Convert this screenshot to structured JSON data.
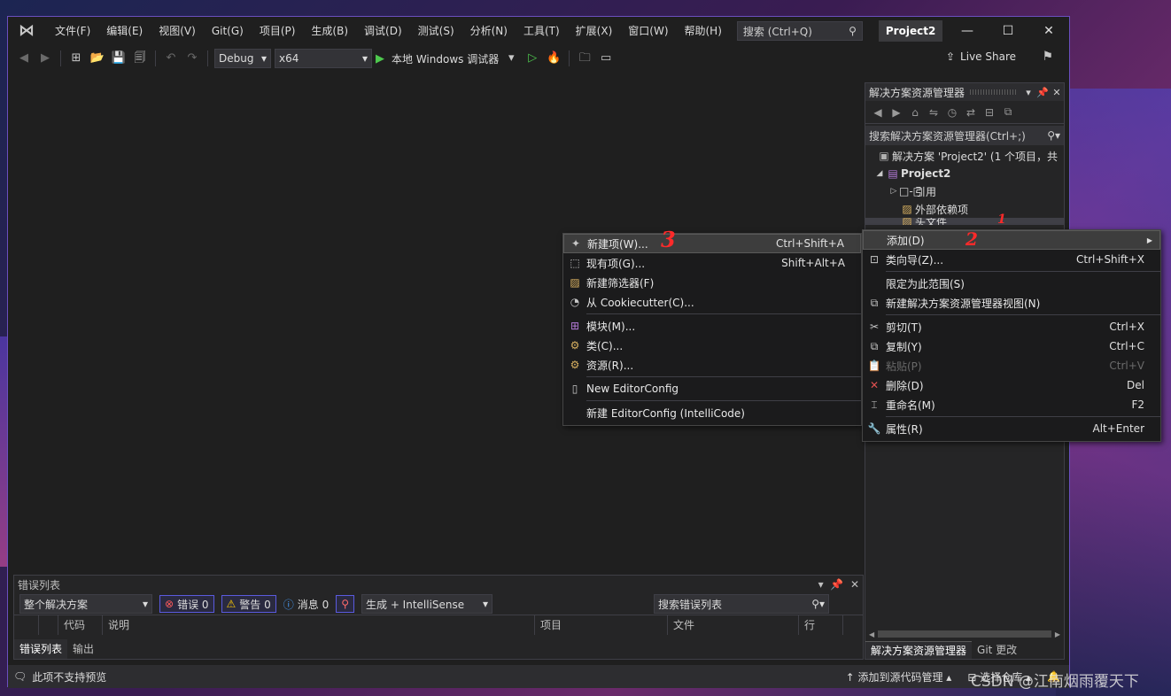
{
  "app": {
    "menu": [
      "文件(F)",
      "编辑(E)",
      "视图(V)",
      "Git(G)",
      "项目(P)",
      "生成(B)",
      "调试(D)",
      "测试(S)",
      "分析(N)",
      "工具(T)",
      "扩展(X)",
      "窗口(W)",
      "帮助(H)"
    ],
    "search_placeholder": "搜索 (Ctrl+Q)",
    "project_badge": "Project2"
  },
  "toolbar": {
    "config": "Debug",
    "platform": "x64",
    "run_label": "本地 Windows 调试器",
    "live_share": "Live Share"
  },
  "solution_explorer": {
    "title": "解决方案资源管理器",
    "search_placeholder": "搜索解决方案资源管理器(Ctrl+;)",
    "tree": [
      {
        "label": "解决方案 'Project2' (1 个项目，共",
        "level": 0
      },
      {
        "label": "Project2",
        "level": 1
      },
      {
        "label": "引用",
        "level": 2
      },
      {
        "label": "外部依赖项",
        "level": 2
      },
      {
        "label": "头文件",
        "level": 2
      }
    ],
    "tabs": [
      "解决方案资源管理器",
      "Git 更改"
    ]
  },
  "context_menu_main": {
    "items": [
      {
        "label": "添加(D)",
        "shortcut": "",
        "icon": "none",
        "submenu": true,
        "highlight": true
      },
      {
        "label": "类向导(Z)...",
        "shortcut": "Ctrl+Shift+X",
        "icon": "class-wizard-icon"
      },
      {
        "label": "限定为此范围(S)",
        "shortcut": "",
        "icon": "none"
      },
      {
        "label": "新建解决方案资源管理器视图(N)",
        "shortcut": "",
        "icon": "new-view-icon"
      },
      {
        "label": "剪切(T)",
        "shortcut": "Ctrl+X",
        "icon": "scissors-icon"
      },
      {
        "label": "复制(Y)",
        "shortcut": "Ctrl+C",
        "icon": "copy-icon"
      },
      {
        "label": "粘贴(P)",
        "shortcut": "Ctrl+V",
        "icon": "paste-icon",
        "disabled": true
      },
      {
        "label": "删除(D)",
        "shortcut": "Del",
        "icon": "delete-icon"
      },
      {
        "label": "重命名(M)",
        "shortcut": "F2",
        "icon": "rename-icon"
      },
      {
        "label": "属性(R)",
        "shortcut": "Alt+Enter",
        "icon": "wrench-icon"
      }
    ]
  },
  "context_menu_add": {
    "items": [
      {
        "label": "新建项(W)...",
        "shortcut": "Ctrl+Shift+A",
        "icon": "new-item-icon",
        "highlight": true
      },
      {
        "label": "现有项(G)...",
        "shortcut": "Shift+Alt+A",
        "icon": "existing-item-icon"
      },
      {
        "label": "新建筛选器(F)",
        "shortcut": "",
        "icon": "new-filter-icon"
      },
      {
        "label": "从 Cookiecutter(C)...",
        "shortcut": "",
        "icon": "cookiecutter-icon"
      },
      {
        "label": "模块(M)...",
        "shortcut": "",
        "icon": "module-icon"
      },
      {
        "label": "类(C)...",
        "shortcut": "",
        "icon": "class-icon"
      },
      {
        "label": "资源(R)...",
        "shortcut": "",
        "icon": "resource-icon"
      },
      {
        "label": "New EditorConfig",
        "shortcut": "",
        "icon": "file-icon"
      },
      {
        "label": "新建 EditorConfig (IntelliCode)",
        "shortcut": "",
        "icon": "none"
      }
    ]
  },
  "error_list": {
    "title": "错误列表",
    "scope": "整个解决方案",
    "errors_label": "错误 0",
    "warnings_label": "警告 0",
    "messages_label": "消息 0",
    "build_filter": "生成 + IntelliSense",
    "search_placeholder": "搜索错误列表",
    "columns": [
      "代码",
      "说明",
      "项目",
      "文件",
      "行"
    ],
    "tabs": [
      "错误列表",
      "输出"
    ]
  },
  "status_bar": {
    "left": "此项不支持预览",
    "add_source": "添加到源代码管理",
    "select_repo": "选择仓库"
  },
  "annotations": [
    "1",
    "2",
    "3"
  ],
  "watermark": "CSDN @江南烟雨覆天下",
  "colors": {
    "accent_border": "#6b4fbf",
    "annotation": "#ff2a2a",
    "play": "#4ec94e"
  }
}
